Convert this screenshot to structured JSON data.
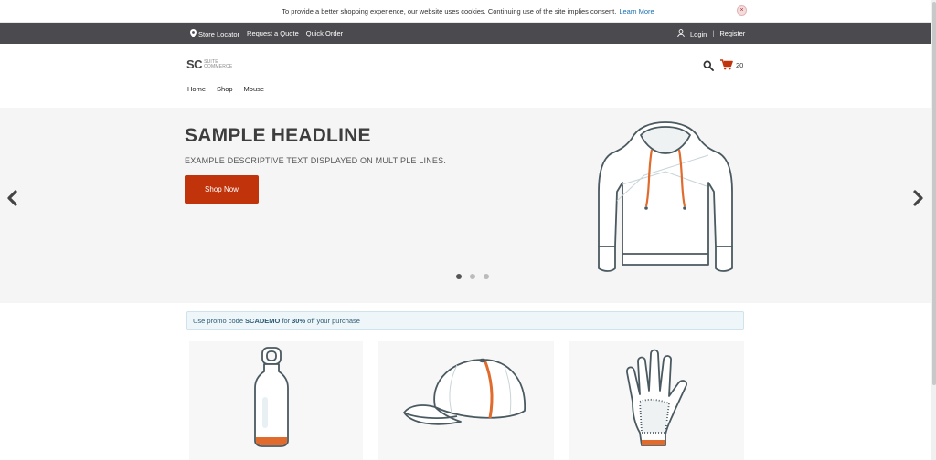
{
  "cookie": {
    "message": "To provide a better shopping experience, our website uses cookies. Continuing use of the site implies consent.",
    "link": "Learn More",
    "close": "×"
  },
  "topbar": {
    "links": [
      "Store Locator",
      "Request a Quote",
      "Quick Order"
    ],
    "login": "Login",
    "separator": "|",
    "register": "Register",
    "icons": {
      "location": "map-pin-icon",
      "account": "user-icon"
    }
  },
  "header": {
    "logo": {
      "mark": "SC",
      "line1": "SUITE",
      "line2": "COMMERCE"
    },
    "cart_count": "20",
    "icons": {
      "search": "search-icon",
      "cart": "shopping-cart-icon"
    },
    "nav": [
      "Home",
      "Shop",
      "Mouse"
    ]
  },
  "hero": {
    "headline": "SAMPLE HEADLINE",
    "text": "EXAMPLE DESCRIPTIVE TEXT DISPLAYED ON MULTIPLE LINES.",
    "button": "Shop Now",
    "active_slide": 1,
    "slide_count": 3,
    "icons": {
      "prev": "chevron-left-icon",
      "next": "chevron-right-icon",
      "image": "hoodie-illustration"
    }
  },
  "promo": {
    "prefix": "Use promo code",
    "code": "SCADEMO",
    "middle": "for",
    "discount": "30%",
    "suffix": "off your purchase"
  },
  "products": [
    {
      "image": "water-bottle-illustration"
    },
    {
      "image": "baseball-cap-illustration"
    },
    {
      "image": "glove-illustration"
    }
  ],
  "colors": {
    "accent": "#c1330b",
    "topbar": "#4a4a4f",
    "hero_bg": "#f5f5f5",
    "promo_bg": "#eef6fa",
    "outline": "#4a5a60"
  }
}
